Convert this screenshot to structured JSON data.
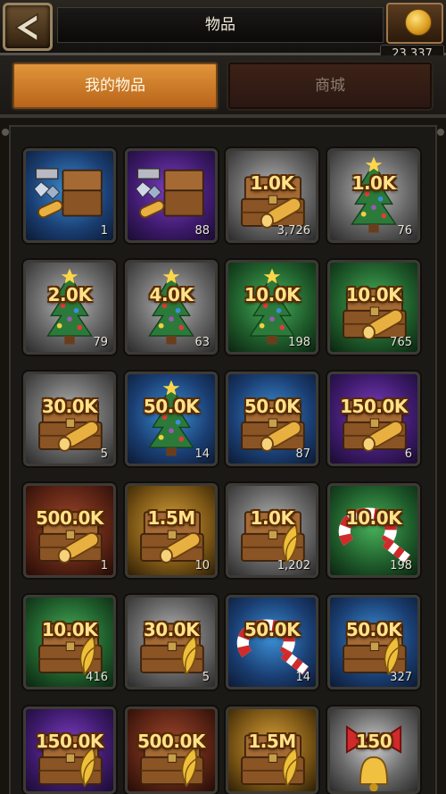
{
  "header": {
    "title": "物品",
    "coins": "23,337"
  },
  "tabs": [
    {
      "label": "我的物品"
    },
    {
      "label": "商城"
    }
  ],
  "items": [
    {
      "icon": "gems-chest-icon",
      "bg": "blue",
      "amount": "",
      "count": "1"
    },
    {
      "icon": "gems-chest-icon",
      "bg": "purple",
      "amount": "",
      "count": "88"
    },
    {
      "icon": "wood-chest-icon",
      "bg": "gray",
      "amount": "1.0K",
      "count": "3,726"
    },
    {
      "icon": "christmas-tree-icon",
      "bg": "gray",
      "amount": "1.0K",
      "count": "76"
    },
    {
      "icon": "christmas-tree-icon",
      "bg": "gray",
      "amount": "2.0K",
      "count": "79"
    },
    {
      "icon": "christmas-tree-icon",
      "bg": "gray",
      "amount": "4.0K",
      "count": "63"
    },
    {
      "icon": "christmas-tree-icon",
      "bg": "green",
      "amount": "10.0K",
      "count": "198"
    },
    {
      "icon": "wood-chest-icon",
      "bg": "green",
      "amount": "10.0K",
      "count": "765"
    },
    {
      "icon": "wood-chest-icon",
      "bg": "gray",
      "amount": "30.0K",
      "count": "5"
    },
    {
      "icon": "christmas-tree-icon",
      "bg": "blue",
      "amount": "50.0K",
      "count": "14"
    },
    {
      "icon": "wood-chest-icon",
      "bg": "blue",
      "amount": "50.0K",
      "count": "87"
    },
    {
      "icon": "wood-chest-icon",
      "bg": "purple",
      "amount": "150.0K",
      "count": "6"
    },
    {
      "icon": "wood-chest-icon",
      "bg": "brown",
      "amount": "500.0K",
      "count": "1"
    },
    {
      "icon": "wood-chest-icon",
      "bg": "gold",
      "amount": "1.5M",
      "count": "10"
    },
    {
      "icon": "grain-chest-icon",
      "bg": "gray",
      "amount": "1.0K",
      "count": "1,202"
    },
    {
      "icon": "candy-cane-icon",
      "bg": "green",
      "amount": "10.0K",
      "count": "198"
    },
    {
      "icon": "grain-chest-icon",
      "bg": "green",
      "amount": "10.0K",
      "count": "416"
    },
    {
      "icon": "grain-chest-icon",
      "bg": "gray",
      "amount": "30.0K",
      "count": "5"
    },
    {
      "icon": "candy-cane-icon",
      "bg": "blue",
      "amount": "50.0K",
      "count": "14"
    },
    {
      "icon": "grain-chest-icon",
      "bg": "blue",
      "amount": "50.0K",
      "count": "327"
    },
    {
      "icon": "grain-chest-icon",
      "bg": "purple",
      "amount": "150.0K",
      "count": ""
    },
    {
      "icon": "grain-chest-icon",
      "bg": "brown",
      "amount": "500.0K",
      "count": ""
    },
    {
      "icon": "grain-chest-icon",
      "bg": "gold",
      "amount": "1.5M",
      "count": ""
    },
    {
      "icon": "bell-ribbon-icon",
      "bg": "red",
      "amount": "150",
      "count": ""
    }
  ]
}
